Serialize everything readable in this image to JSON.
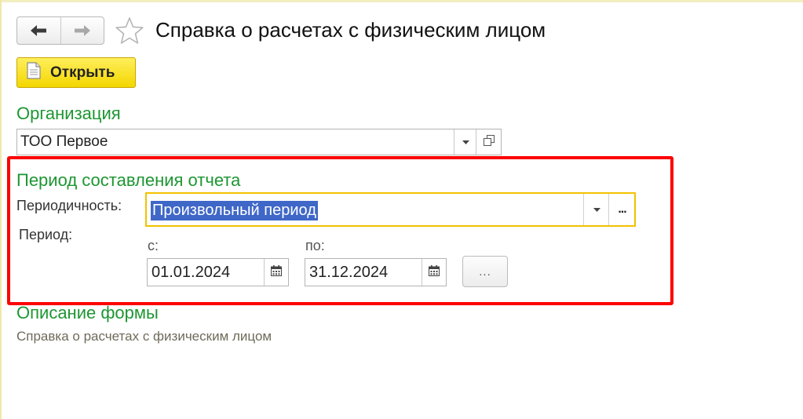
{
  "header": {
    "back_icon": "arrow-left-icon",
    "forward_icon": "arrow-right-icon",
    "favorite_icon": "star-outline-icon",
    "title": "Справка о расчетах с физическим лицом"
  },
  "toolbar": {
    "open_label": "Открыть",
    "open_icon": "document-icon",
    "open_color": "#f7dc16"
  },
  "organization": {
    "section_title": "Организация",
    "value": "ТОО Первое"
  },
  "period_section": {
    "section_title": "Период составления отчета",
    "periodicity_label": "Периодичность:",
    "periodicity_value": "Произвольный период",
    "period_label": "Период:",
    "from_label": "с:",
    "from_value": "01.01.2024",
    "to_label": "по:",
    "to_value": "31.12.2024",
    "select_period_label": "...",
    "more_label": "...",
    "highlight_color": "#ff0000"
  },
  "description": {
    "section_title": "Описание формы",
    "text": "Справка о расчетах с физическим лицом"
  },
  "colors": {
    "section_green": "#1e9632",
    "selection_blue": "#3f67c8",
    "focus_yellow": "#f2c200"
  }
}
